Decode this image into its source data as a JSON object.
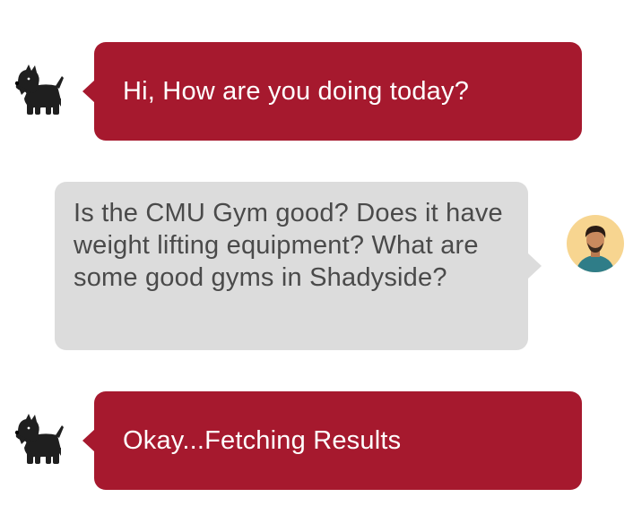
{
  "conversation": {
    "messages": [
      {
        "sender": "bot",
        "avatar_icon": "scottie-dog-icon",
        "text": "Hi, How are you doing today?"
      },
      {
        "sender": "user",
        "avatar_icon": "user-avatar",
        "text": "Is the CMU Gym good? Does it have weight lifting equipment? What are some good gyms in Shadyside?"
      },
      {
        "sender": "bot",
        "avatar_icon": "scottie-dog-icon",
        "text": "Okay...Fetching Results"
      }
    ]
  },
  "colors": {
    "bot_bubble": "#A6192E",
    "bot_text": "#FFFFFF",
    "user_bubble": "#DCDCDC",
    "user_text": "#4A4A4A",
    "user_avatar_bg": "#F7D590"
  }
}
